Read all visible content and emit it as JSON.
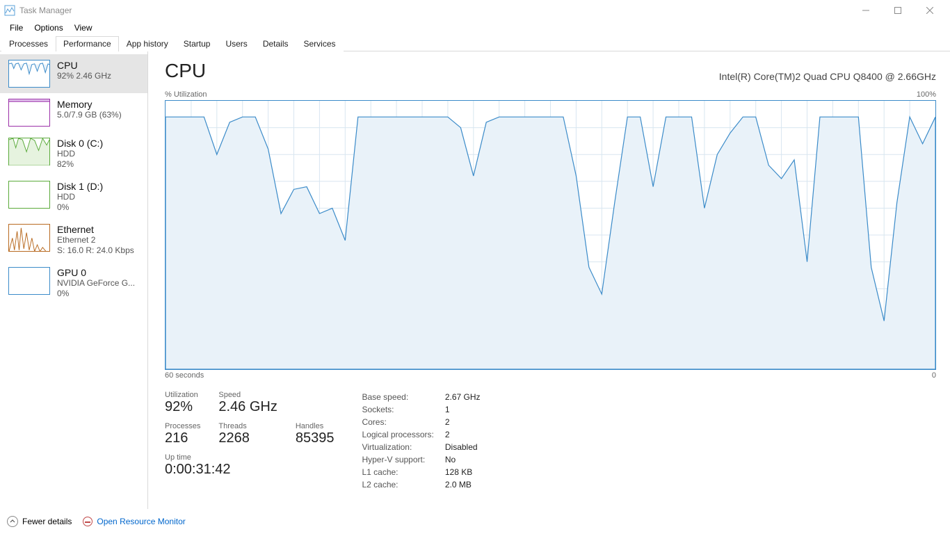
{
  "window": {
    "title": "Task Manager"
  },
  "menu": {
    "file": "File",
    "options": "Options",
    "view": "View"
  },
  "tabs": {
    "processes": "Processes",
    "performance": "Performance",
    "app_history": "App history",
    "startup": "Startup",
    "users": "Users",
    "details": "Details",
    "services": "Services"
  },
  "sidebar": {
    "cpu": {
      "title": "CPU",
      "sub": "92%  2.46 GHz"
    },
    "memory": {
      "title": "Memory",
      "sub": "5.0/7.9 GB (63%)"
    },
    "disk0": {
      "title": "Disk 0 (C:)",
      "sub1": "HDD",
      "sub2": "82%"
    },
    "disk1": {
      "title": "Disk 1 (D:)",
      "sub1": "HDD",
      "sub2": "0%"
    },
    "eth": {
      "title": "Ethernet",
      "sub1": "Ethernet 2",
      "sub2": "S: 16.0  R: 24.0 Kbps"
    },
    "gpu": {
      "title": "GPU 0",
      "sub1": "NVIDIA GeForce G...",
      "sub2": "0%"
    }
  },
  "header": {
    "title": "CPU",
    "device": "Intel(R) Core(TM)2 Quad CPU Q8400 @ 2.66GHz",
    "axis_top_left": "% Utilization",
    "axis_top_right": "100%",
    "axis_bot_left": "60 seconds",
    "axis_bot_right": "0"
  },
  "stats": {
    "utilization": {
      "label": "Utilization",
      "value": "92%"
    },
    "speed": {
      "label": "Speed",
      "value": "2.46 GHz"
    },
    "processes": {
      "label": "Processes",
      "value": "216"
    },
    "threads": {
      "label": "Threads",
      "value": "2268"
    },
    "handles": {
      "label": "Handles",
      "value": "85395"
    },
    "uptime": {
      "label": "Up time",
      "value": "0:00:31:42"
    }
  },
  "sys": {
    "base_speed": {
      "label": "Base speed:",
      "value": "2.67 GHz"
    },
    "sockets": {
      "label": "Sockets:",
      "value": "1"
    },
    "cores": {
      "label": "Cores:",
      "value": "2"
    },
    "logical": {
      "label": "Logical processors:",
      "value": "2"
    },
    "virtualization": {
      "label": "Virtualization:",
      "value": "Disabled"
    },
    "hyperv": {
      "label": "Hyper-V support:",
      "value": "No"
    },
    "l1": {
      "label": "L1 cache:",
      "value": "128 KB"
    },
    "l2": {
      "label": "L2 cache:",
      "value": "2.0 MB"
    }
  },
  "footer": {
    "fewer": "Fewer details",
    "rm": "Open Resource Monitor"
  },
  "colors": {
    "cpu": "#3b8bc9",
    "cpu_fill": "#e9f2f9",
    "memory": "#9b2fa8",
    "disk": "#5aaa3a",
    "eth": "#b86a20",
    "gpu": "#3b8bc9"
  },
  "chart_data": {
    "type": "area",
    "title": "% Utilization",
    "xlabel": "60 seconds → 0",
    "ylabel": "% Utilization",
    "ylim": [
      0,
      100
    ],
    "x_seconds_ago": [
      60,
      59,
      58,
      57,
      56,
      55,
      54,
      53,
      52,
      51,
      50,
      49,
      48,
      47,
      46,
      45,
      44,
      43,
      42,
      41,
      40,
      39,
      38,
      37,
      36,
      35,
      34,
      33,
      32,
      31,
      30,
      29,
      28,
      27,
      26,
      25,
      24,
      23,
      22,
      21,
      20,
      19,
      18,
      17,
      16,
      15,
      14,
      13,
      12,
      11,
      10,
      9,
      8,
      7,
      6,
      5,
      4,
      3,
      2,
      1,
      0
    ],
    "values": [
      94,
      94,
      94,
      94,
      80,
      92,
      94,
      94,
      82,
      58,
      67,
      68,
      58,
      60,
      48,
      94,
      94,
      94,
      94,
      94,
      94,
      94,
      94,
      90,
      72,
      92,
      94,
      94,
      94,
      94,
      94,
      94,
      72,
      38,
      28,
      62,
      94,
      94,
      68,
      94,
      94,
      94,
      60,
      80,
      88,
      94,
      94,
      76,
      71,
      78,
      40,
      94,
      94,
      94,
      94,
      38,
      18,
      62,
      94,
      84,
      94
    ]
  }
}
